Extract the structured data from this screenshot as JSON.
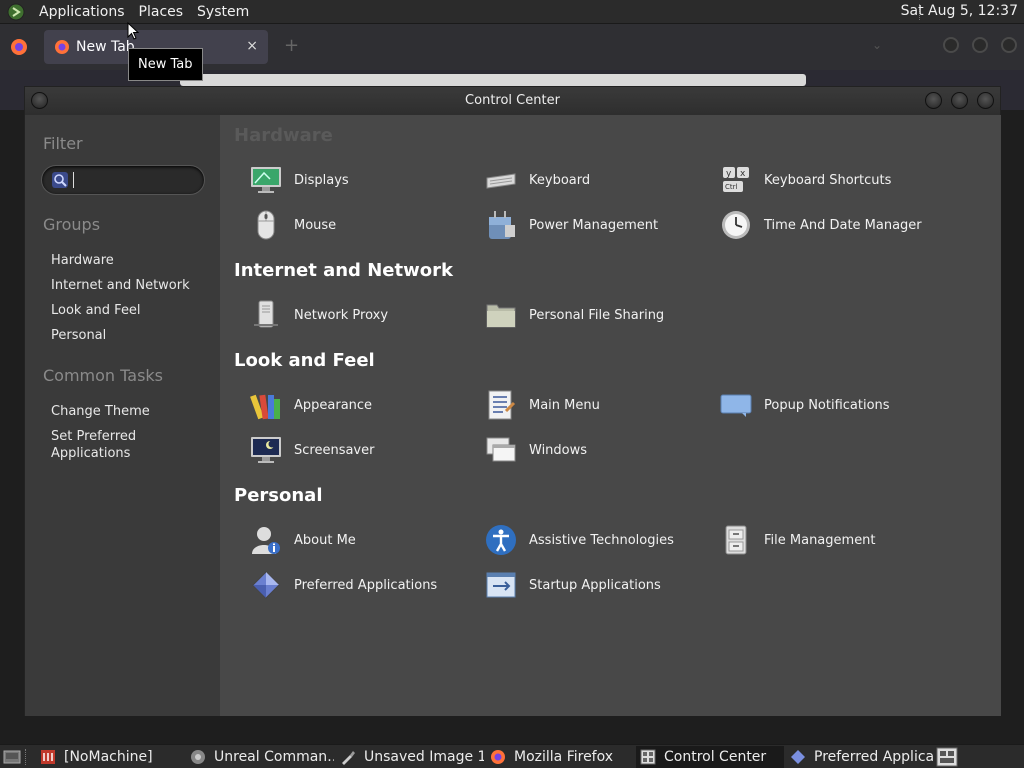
{
  "top_panel": {
    "menus": [
      "Applications",
      "Places",
      "System"
    ],
    "clock": "Sat Aug  5, 12:37"
  },
  "firefox": {
    "tab_title": "New Tab",
    "tab_close": "×",
    "new_tab": "+",
    "tooltip": "New Tab"
  },
  "window": {
    "title": "Control Center"
  },
  "sidebar": {
    "filter_heading": "Filter",
    "search_value": "",
    "groups_heading": "Groups",
    "groups": [
      "Hardware",
      "Internet and Network",
      "Look and Feel",
      "Personal"
    ],
    "tasks_heading": "Common Tasks",
    "tasks": [
      "Change Theme",
      "Set Preferred Applications"
    ]
  },
  "sections": [
    {
      "title": "Hardware",
      "items": [
        {
          "label": "Displays",
          "icon": "display-icon"
        },
        {
          "label": "Keyboard",
          "icon": "keyboard-icon"
        },
        {
          "label": "Keyboard Shortcuts",
          "icon": "keyboard-shortcuts-icon"
        },
        {
          "label": "Mouse",
          "icon": "mouse-icon"
        },
        {
          "label": "Power Management",
          "icon": "power-management-icon"
        },
        {
          "label": "Time And Date Manager",
          "icon": "clock-icon"
        }
      ]
    },
    {
      "title": "Internet and Network",
      "items": [
        {
          "label": "Network Proxy",
          "icon": "network-proxy-icon"
        },
        {
          "label": "Personal File Sharing",
          "icon": "folder-share-icon"
        }
      ]
    },
    {
      "title": "Look and Feel",
      "items": [
        {
          "label": "Appearance",
          "icon": "appearance-icon"
        },
        {
          "label": "Main Menu",
          "icon": "main-menu-icon"
        },
        {
          "label": "Popup Notifications",
          "icon": "notification-icon"
        },
        {
          "label": "Screensaver",
          "icon": "screensaver-icon"
        },
        {
          "label": "Windows",
          "icon": "windows-icon"
        }
      ]
    },
    {
      "title": "Personal",
      "items": [
        {
          "label": "About Me",
          "icon": "about-me-icon"
        },
        {
          "label": "Assistive Technologies",
          "icon": "accessibility-icon"
        },
        {
          "label": "File Management",
          "icon": "file-management-icon"
        },
        {
          "label": "Preferred Applications",
          "icon": "preferred-apps-icon"
        },
        {
          "label": "Startup Applications",
          "icon": "startup-apps-icon"
        }
      ]
    }
  ],
  "taskbar": {
    "tasks": [
      "[NoMachine]",
      "Unreal Comman…",
      "Unsaved Image 1 …",
      "Mozilla Firefox",
      "Control Center",
      "Preferred Applica…"
    ]
  }
}
